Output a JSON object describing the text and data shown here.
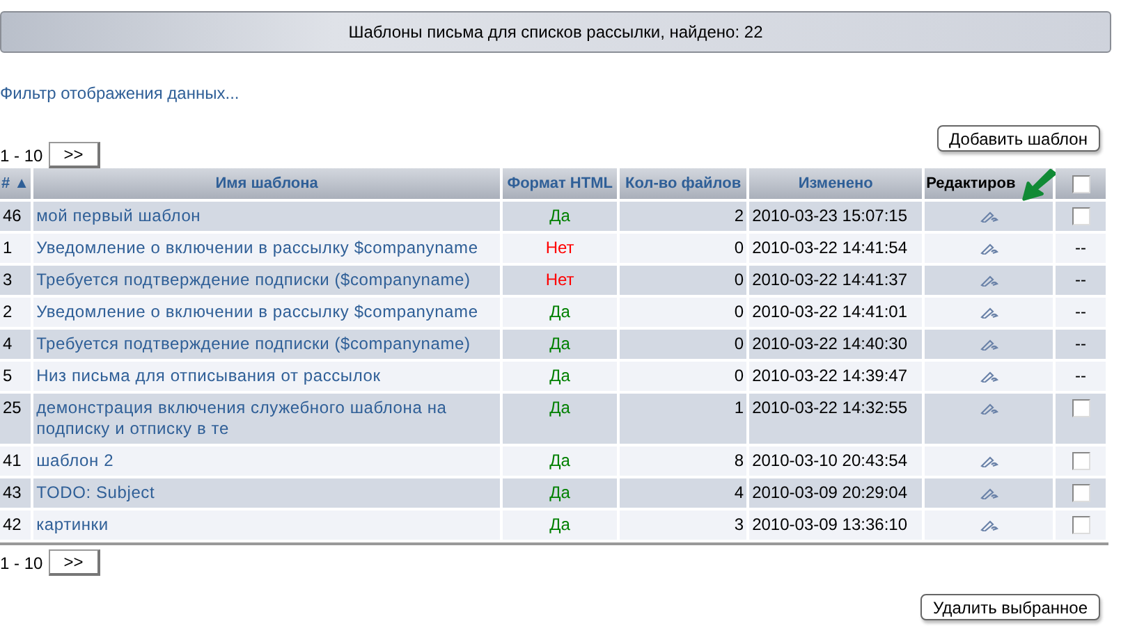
{
  "title": "Шаблоны письма для списков рассылки, найдено: 22",
  "filter_link": "Фильтр отображения данных...",
  "pager_top": {
    "range": "1 - 10",
    "next": ">>"
  },
  "add_button": "Добавить шаблон",
  "table": {
    "columns": [
      {
        "label": "#",
        "sort": "▲"
      },
      {
        "label": "Имя шаблона"
      },
      {
        "label": "Формат HTML"
      },
      {
        "label": "Кол-во файлов"
      },
      {
        "label": "Изменено"
      },
      {
        "label": "Редактиров"
      }
    ],
    "select_all": {
      "checked": false
    },
    "rows": [
      {
        "id": "46",
        "name": "мой первый шаблон",
        "format": {
          "text": "Да",
          "color": "#008000"
        },
        "files": "2",
        "changed": "2010-03-23 15:07:15",
        "select": {
          "kind": "checkbox",
          "checked": false
        }
      },
      {
        "id": "1",
        "name": "Уведомление о включении в рассылку $companyname",
        "format": {
          "text": "Нет",
          "color": "#ff0000"
        },
        "files": "0",
        "changed": "2010-03-22 14:41:54",
        "select": {
          "kind": "none",
          "text": "--"
        }
      },
      {
        "id": "3",
        "name": "Требуется подтверждение подписки ($companyname)",
        "format": {
          "text": "Нет",
          "color": "#ff0000"
        },
        "files": "0",
        "changed": "2010-03-22 14:41:37",
        "select": {
          "kind": "none",
          "text": "--"
        }
      },
      {
        "id": "2",
        "name": "Уведомление о включении в рассылку $companyname",
        "format": {
          "text": "Да",
          "color": "#008000"
        },
        "files": "0",
        "changed": "2010-03-22 14:41:01",
        "select": {
          "kind": "none",
          "text": "--"
        }
      },
      {
        "id": "4",
        "name": "Требуется подтверждение подписки ($companyname)",
        "format": {
          "text": "Да",
          "color": "#008000"
        },
        "files": "0",
        "changed": "2010-03-22 14:40:30",
        "select": {
          "kind": "none",
          "text": "--"
        }
      },
      {
        "id": "5",
        "name": "Низ письма для отписывания от рассылок",
        "format": {
          "text": "Да",
          "color": "#008000"
        },
        "files": "0",
        "changed": "2010-03-22 14:39:47",
        "select": {
          "kind": "none",
          "text": "--"
        }
      },
      {
        "id": "25",
        "name": "демонстрация включения служебного шаблона на подписку и отписку в те",
        "format": {
          "text": "Да",
          "color": "#008000"
        },
        "files": "1",
        "changed": "2010-03-22 14:32:55",
        "select": {
          "kind": "checkbox",
          "checked": false
        }
      },
      {
        "id": "41",
        "name": "шаблон 2",
        "format": {
          "text": "Да",
          "color": "#008000"
        },
        "files": "8",
        "changed": "2010-03-10 20:43:54",
        "select": {
          "kind": "checkbox",
          "checked": false
        }
      },
      {
        "id": "43",
        "name": "TODO: Subject",
        "format": {
          "text": "Да",
          "color": "#008000"
        },
        "files": "4",
        "changed": "2010-03-09 20:29:04",
        "select": {
          "kind": "checkbox",
          "checked": false
        }
      },
      {
        "id": "42",
        "name": "картинки",
        "format": {
          "text": "Да",
          "color": "#008000"
        },
        "files": "3",
        "changed": "2010-03-09 13:36:10",
        "select": {
          "kind": "checkbox",
          "checked": false
        }
      }
    ]
  },
  "pager_bottom": {
    "range": "1 - 10",
    "next": ">>"
  },
  "delete_button": "Удалить выбранное"
}
